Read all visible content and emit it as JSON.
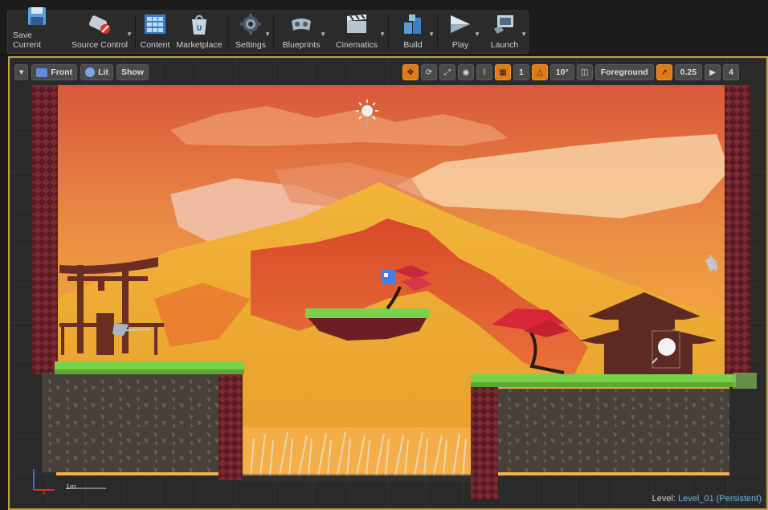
{
  "toolbar": {
    "buttons": [
      {
        "label": "Save Current",
        "icon": "save-icon"
      },
      {
        "label": "Source Control",
        "icon": "source-control-icon"
      },
      {
        "label": "Content",
        "icon": "content-icon"
      },
      {
        "label": "Marketplace",
        "icon": "marketplace-icon"
      },
      {
        "label": "Settings",
        "icon": "settings-icon"
      },
      {
        "label": "Blueprints",
        "icon": "blueprints-icon"
      },
      {
        "label": "Cinematics",
        "icon": "cinematics-icon"
      },
      {
        "label": "Build",
        "icon": "build-icon"
      },
      {
        "label": "Play",
        "icon": "play-icon"
      },
      {
        "label": "Launch",
        "icon": "launch-icon"
      }
    ]
  },
  "viewport": {
    "view_mode": "Front",
    "lighting": "Lit",
    "show": "Show",
    "grid_snap": "1",
    "rotation_snap": "10°",
    "layer": "Foreground",
    "scale_snap": "0.25",
    "camera_speed": "4",
    "scale_label": "1m",
    "level_prefix": "Level:",
    "level_name": "Level_01 (Persistent)"
  },
  "colors": {
    "accent": "#e07a16",
    "border": "#c3a23a",
    "level": "#6fb3e0"
  }
}
